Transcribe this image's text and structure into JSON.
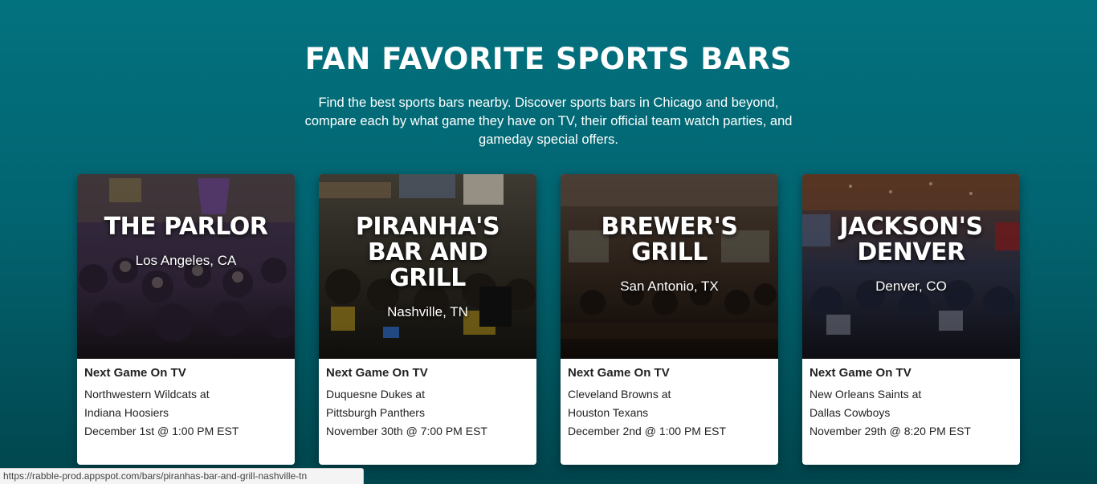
{
  "section": {
    "title": "FAN FAVORITE SPORTS BARS",
    "description": "Find the best sports bars nearby. Discover sports bars in Chicago and beyond, compare each by what game they have on TV, their official team watch parties, and gameday special offers."
  },
  "cards": [
    {
      "name": "THE PARLOR",
      "city": "Los Angeles, CA",
      "label": "Next Game On TV",
      "team_line_1": "Northwestern Wildcats at",
      "team_line_2": "Indiana Hoosiers",
      "date": "December 1st @ 1:00 PM EST",
      "image_colors": [
        "#3b2f4a",
        "#5a3f6e",
        "#231a2a"
      ]
    },
    {
      "name": "PIRANHA'S BAR AND GRILL",
      "city": "Nashville, TN",
      "label": "Next Game On TV",
      "team_line_1": "Duquesne Dukes at",
      "team_line_2": "Pittsburgh Panthers",
      "date": "November 30th @ 7:00 PM EST",
      "image_colors": [
        "#3d3a2e",
        "#2a2620",
        "#1a1812"
      ]
    },
    {
      "name": "BREWER'S GRILL",
      "city": "San Antonio, TX",
      "label": "Next Game On TV",
      "team_line_1": "Cleveland Browns at",
      "team_line_2": "Houston Texans",
      "date": "December 2nd @ 1:00 PM EST",
      "image_colors": [
        "#4a3a30",
        "#3a2a22",
        "#1c1410"
      ]
    },
    {
      "name": "JACKSON'S DENVER",
      "city": "Denver, CO",
      "label": "Next Game On TV",
      "team_line_1": "New Orleans Saints at",
      "team_line_2": "Dallas Cowboys",
      "date": "November 29th @ 8:20 PM EST",
      "image_colors": [
        "#5a3a2a",
        "#2e3a52",
        "#1a1a22"
      ]
    }
  ],
  "status_bar": {
    "url": "https://rabble-prod.appspot.com/bars/piranhas-bar-and-grill-nashville-tn"
  }
}
